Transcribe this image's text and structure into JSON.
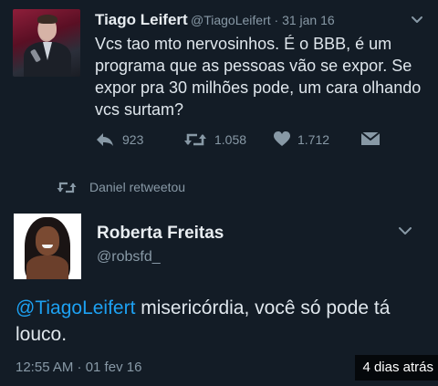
{
  "tweet": {
    "author_name": "Tiago Leifert",
    "author_handle": "@TiagoLeifert",
    "separator": "·",
    "date": "31 jan 16",
    "text": "Vcs tao mto nervosinhos. É o BBB, é um programa que as pessoas vão se expor. Se expor pra 30 milhões pode, um cara olhando vcs surtam?",
    "replies": "923",
    "retweets": "1.058",
    "likes": "1.712"
  },
  "retweet_label": "Daniel retweetou",
  "reply": {
    "author_name": "Roberta Freitas",
    "author_handle": "@robsfd_",
    "mention": "@TiagoLeifert",
    "text": " misericórdia, você só pode tá louco.",
    "timestamp": "12:55 AM · 01 fev 16"
  },
  "overlay_label": "4 dias atrás",
  "colors": {
    "background": "#131c26",
    "text": "#dfe6ec",
    "secondary": "#8899a6",
    "link": "#1da1f2"
  },
  "icons": [
    "reply-icon",
    "retweet-icon",
    "like-icon",
    "dm-icon",
    "chevron-down-icon"
  ]
}
